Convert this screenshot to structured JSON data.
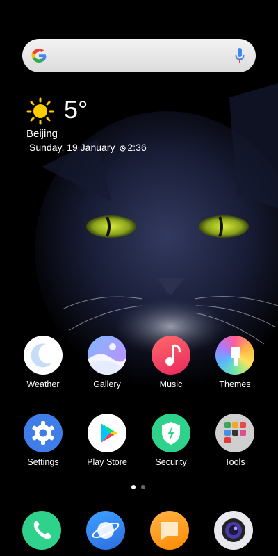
{
  "search": {
    "google_icon": "google-g-icon",
    "mic_icon": "microphone-icon"
  },
  "weather": {
    "temperature": "5°",
    "city": "Beijing",
    "date": "Sunday, 19 January",
    "time": "2:36",
    "icon": "sun-icon"
  },
  "apps": [
    {
      "label": "Weather",
      "icon": "moon-icon"
    },
    {
      "label": "Gallery",
      "icon": "gallery-icon"
    },
    {
      "label": "Music",
      "icon": "music-note-icon"
    },
    {
      "label": "Themes",
      "icon": "brush-icon"
    },
    {
      "label": "Settings",
      "icon": "gear-icon"
    },
    {
      "label": "Play Store",
      "icon": "play-store-icon"
    },
    {
      "label": "Security",
      "icon": "shield-icon"
    },
    {
      "label": "Tools",
      "icon": "folder-icon"
    }
  ],
  "dock": [
    {
      "icon": "phone-icon"
    },
    {
      "icon": "browser-icon"
    },
    {
      "icon": "messages-icon"
    },
    {
      "icon": "camera-icon"
    }
  ],
  "page_indicator": {
    "count": 2,
    "active": 1
  },
  "colors": {
    "accent_green": "#2fd28a",
    "music_red": "#f24e5c"
  }
}
